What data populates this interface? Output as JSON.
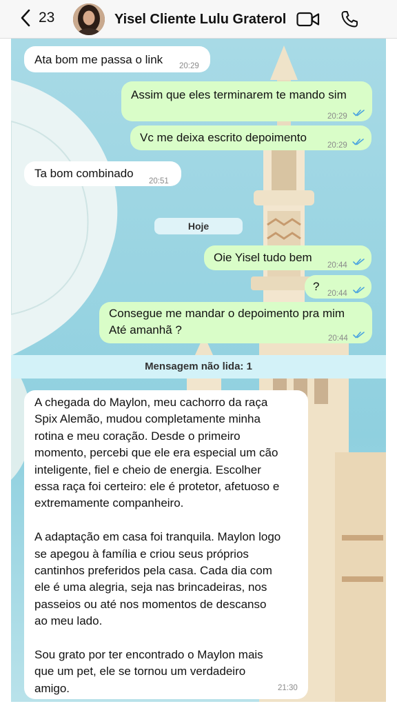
{
  "header": {
    "back_count": "23",
    "contact_name": "Yisel Cliente Lulu Graterol"
  },
  "messages": [
    {
      "dir": "in",
      "text": "Ata bom me passa o link",
      "time": "20:29"
    },
    {
      "dir": "out",
      "text": "Assim que eles terminarem te mando sim",
      "time": "20:29",
      "status": "read"
    },
    {
      "dir": "out",
      "text": "Vc me deixa escrito depoimento",
      "time": "20:29",
      "status": "read"
    },
    {
      "dir": "in",
      "text": "Ta bom combinado",
      "time": "20:51"
    },
    {
      "dir": "out",
      "text": "Oie Yisel tudo bem",
      "time": "20:44",
      "status": "read"
    },
    {
      "dir": "out",
      "text": "?",
      "time": "20:44",
      "status": "read"
    },
    {
      "dir": "out",
      "lines": [
        "Consegue me mandar o depoimento pra mim",
        "Até amanhã ?"
      ],
      "time": "20:44",
      "status": "read"
    }
  ],
  "date_divider": "Hoje",
  "unread_banner": "Mensagem não lida: 1",
  "long_message": {
    "paragraphs": [
      [
        "A chegada do Maylon, meu cachorro da raça",
        "Spix Alemão, mudou completamente minha",
        "rotina e meu coração. Desde o primeiro",
        "momento, percebi que ele era especial  um cão",
        "inteligente, fiel e cheio de energia. Escolher",
        "essa raça foi certeiro: ele é protetor, afetuoso e",
        "extremamente companheiro."
      ],
      [
        "A adaptação em casa foi tranquila. Maylon logo",
        "se apegou à família e criou seus próprios",
        "cantinhos preferidos pela casa. Cada dia com",
        "ele é uma alegria, seja nas brincadeiras, nos",
        "passeios ou até nos momentos de descanso",
        "ao meu lado."
      ],
      [
        "Sou grato por ter encontrado o Maylon mais",
        "que um pet, ele se tornou um verdadeiro",
        "amigo."
      ]
    ],
    "time": "21:30"
  },
  "colors": {
    "incoming_bubble": "#ffffff",
    "outgoing_bubble": "#d9fdc8",
    "read_ticks": "#4aa3df",
    "sky": "#9fd6e4"
  },
  "icons": [
    "chevron-left-icon",
    "video-camera-icon",
    "phone-icon",
    "double-check-icon"
  ]
}
